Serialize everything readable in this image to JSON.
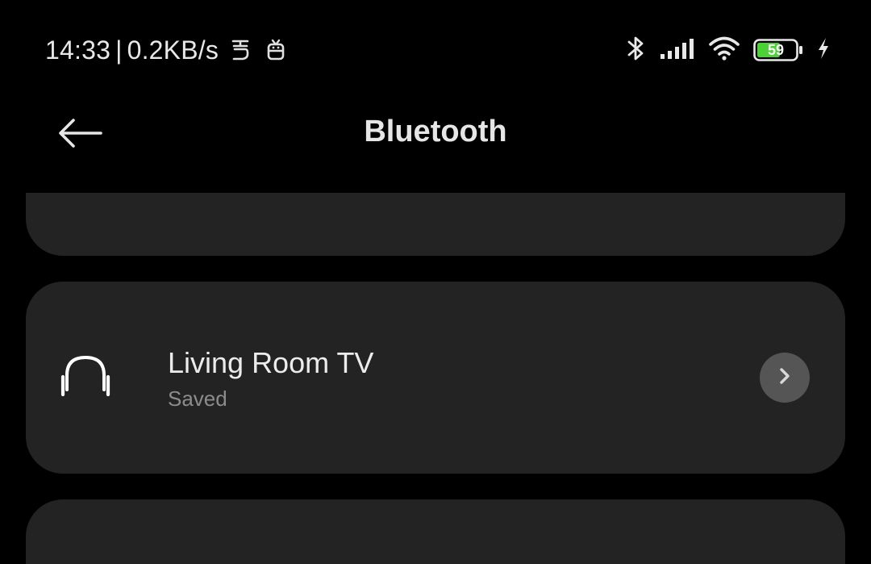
{
  "status_bar": {
    "time": "14:33",
    "separator": "|",
    "network_speed": "0.2KB/s",
    "notification_icons": [
      "notification-app-icon",
      "notification-app-icon"
    ],
    "indicators": [
      "bluetooth-icon",
      "signal-icon",
      "wifi-icon",
      "battery-icon",
      "charging-icon"
    ],
    "battery_level": "59",
    "battery_color": "#4cd137"
  },
  "header": {
    "title": "Bluetooth",
    "back_icon": "arrow-left-icon"
  },
  "devices": [
    {
      "name": "Living Room TV",
      "status": "Saved",
      "icon": "headphones-icon",
      "action_icon": "chevron-right-icon"
    }
  ],
  "colors": {
    "background": "#000000",
    "card": "#232323",
    "primary_text": "#ececec",
    "secondary_text": "#8c8c8c",
    "detail_button": "#555555"
  }
}
